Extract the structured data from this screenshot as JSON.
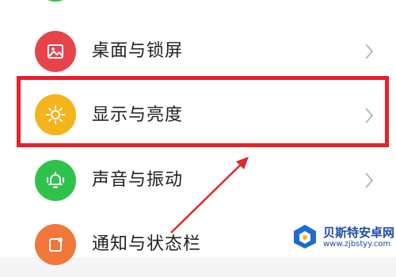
{
  "settings": {
    "items": [
      {
        "label": "",
        "icon": "green-circle-icon",
        "color": "#2fc24b"
      },
      {
        "label": "桌面与锁屏",
        "icon": "image-icon",
        "color": "#e8434b"
      },
      {
        "label": "显示与亮度",
        "icon": "sun-icon",
        "color": "#f4b41c"
      },
      {
        "label": "声音与振动",
        "icon": "bell-icon",
        "color": "#2fc24b"
      },
      {
        "label": "通知与状态栏",
        "icon": "notification-icon",
        "color": "#f2773a"
      }
    ]
  },
  "annotation": {
    "highlight_color": "#e8202a",
    "arrow_color": "#e0282e"
  },
  "watermark": {
    "title": "贝斯特安卓网",
    "url": "www.zjbstyy.com"
  }
}
